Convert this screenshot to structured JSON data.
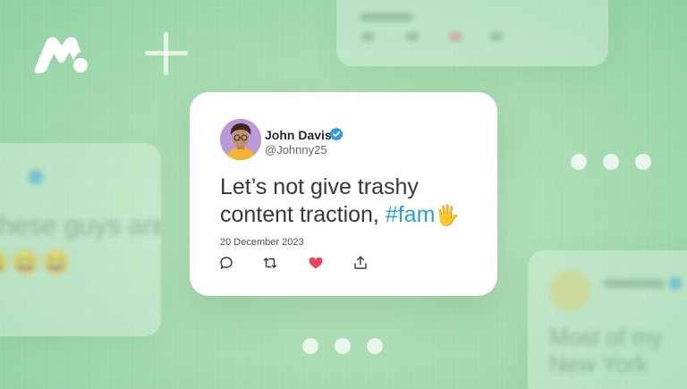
{
  "brand": {
    "logo_icon": "mobiletrans-m-logo-icon",
    "logo_color": "#ffffff"
  },
  "decorations": {
    "plus_icon": "plus-icon"
  },
  "background_cards": {
    "left_text": "these guys are",
    "left_emoji": "😄😄😄",
    "right_text_line1": "Most of my",
    "right_text_line2": "New York"
  },
  "tweet": {
    "author_name": "John Davis",
    "handle": "@Johnny25",
    "verified_icon": "verified-badge-icon",
    "verified_color": "#2a9ce8",
    "text_line1": "Let’s not give trashy",
    "text_line2": "content traction, ",
    "hashtag": "#fam",
    "emoji": "🖐",
    "date": "20 December 2023",
    "actions": [
      {
        "name": "reply",
        "icon": "reply-icon"
      },
      {
        "name": "retweet",
        "icon": "retweet-icon"
      },
      {
        "name": "like",
        "icon": "heart-icon",
        "color": "#e8445a"
      },
      {
        "name": "share",
        "icon": "share-icon"
      }
    ]
  },
  "carousel": {
    "right_dots": 3,
    "bottom_dots": 3
  }
}
